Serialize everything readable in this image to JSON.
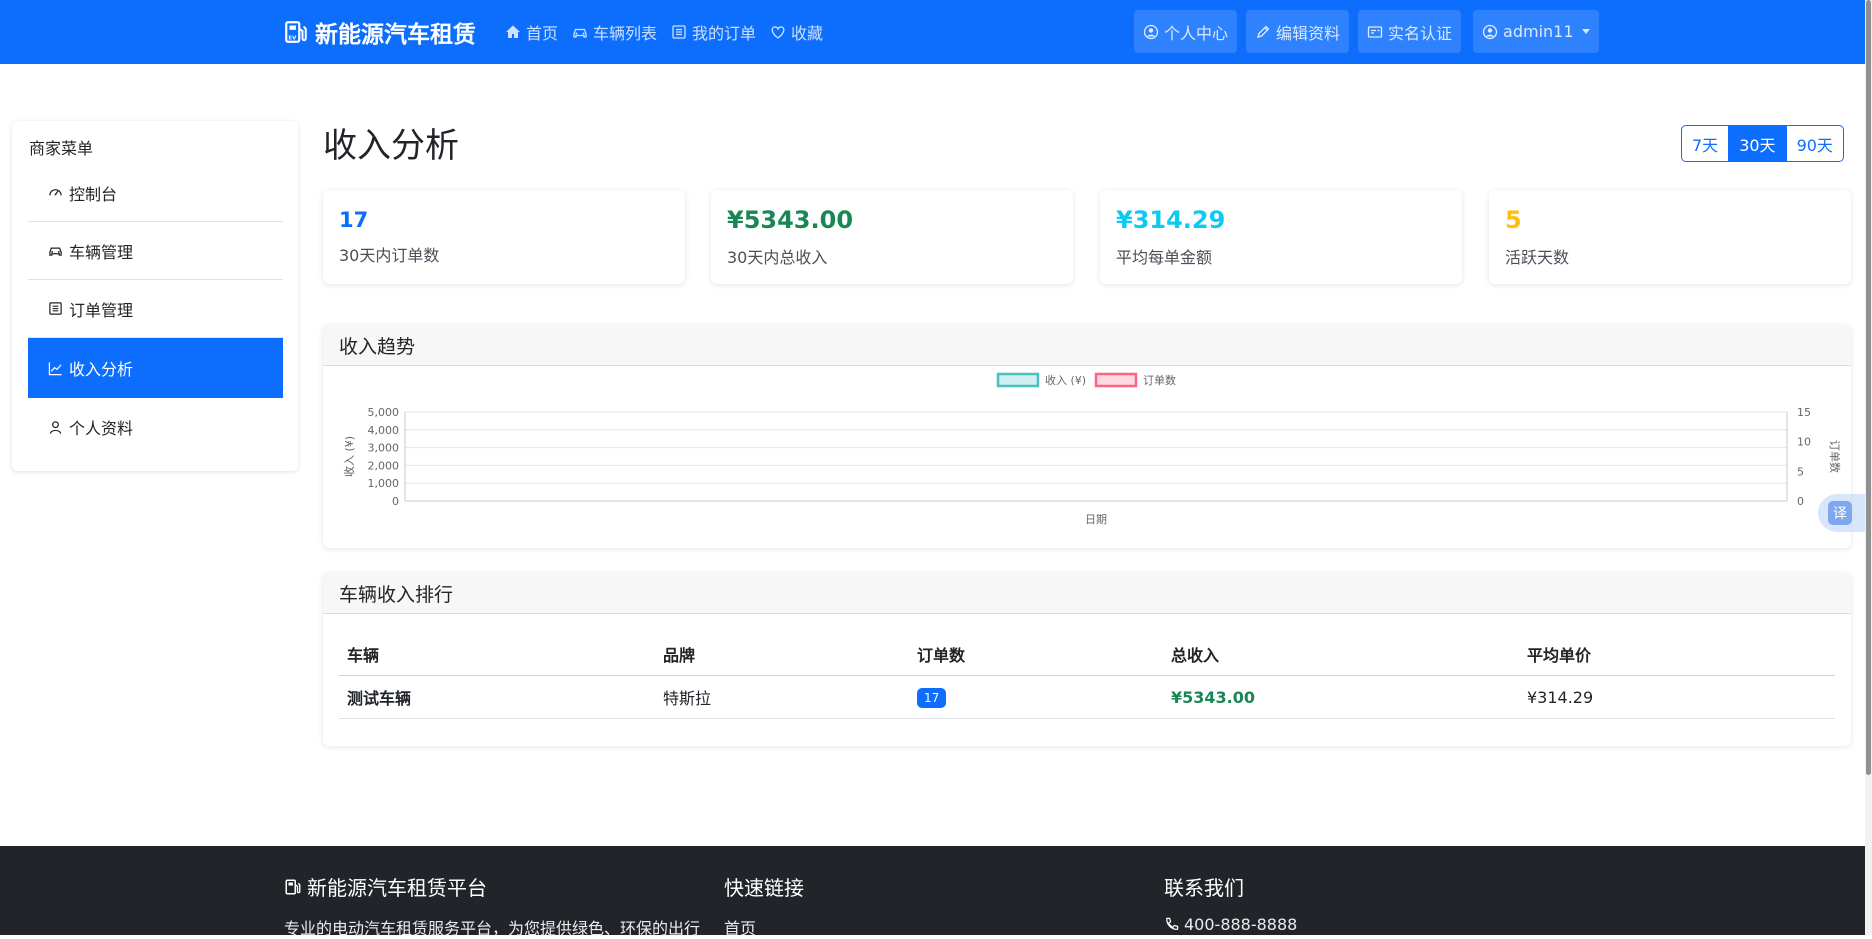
{
  "navbar": {
    "brand": "新能源汽车租赁",
    "links": [
      "首页",
      "车辆列表",
      "我的订单",
      "收藏"
    ],
    "buttons": [
      "个人中心",
      "编辑资料",
      "实名认证"
    ],
    "user": "admin11"
  },
  "sidebar": {
    "title": "商家菜单",
    "items": [
      "控制台",
      "车辆管理",
      "订单管理",
      "收入分析",
      "个人资料"
    ],
    "active": "收入分析"
  },
  "main": {
    "title": "收入分析",
    "ranges": [
      "7天",
      "30天",
      "90天"
    ],
    "active_range": "30天",
    "stats": [
      {
        "value": "17",
        "label": "30天内订单数",
        "color": "#0d6efd"
      },
      {
        "value": "¥5343.00",
        "label": "30天内总收入",
        "color": "#198754"
      },
      {
        "value": "¥314.29",
        "label": "平均每单金额",
        "color": "#0dcaf0"
      },
      {
        "value": "5",
        "label": "活跃天数",
        "color": "#ffc107"
      }
    ]
  },
  "trend": {
    "title": "收入趋势"
  },
  "chart_data": {
    "type": "line",
    "series": [
      {
        "name": "收入 (¥)",
        "values": [],
        "color": "#4bc0c0"
      },
      {
        "name": "订单数",
        "values": [],
        "color": "#ff6384"
      }
    ],
    "x": [],
    "xlabel": "日期",
    "ylabel": "收入 (¥)",
    "y2label": "订单数",
    "ylim": [
      0,
      5000
    ],
    "y2lim": [
      0,
      15
    ],
    "yticks": [
      "5,000",
      "4,000",
      "3,000",
      "2,000",
      "1,000",
      "0"
    ],
    "y2ticks": [
      "15",
      "10",
      "5",
      "0"
    ],
    "legend": "top-center",
    "grid": true
  },
  "ranking": {
    "title": "车辆收入排行",
    "columns": [
      "车辆",
      "品牌",
      "订单数",
      "总收入",
      "平均单价"
    ],
    "rows": [
      {
        "vehicle": "测试车辆",
        "brand": "特斯拉",
        "orders": "17",
        "total": "¥5343.00",
        "avg": "¥314.29"
      }
    ]
  },
  "translate": "译",
  "footer": {
    "brand": "新能源汽车租赁平台",
    "desc": "专业的电动汽车租赁服务平台，为您提供绿色、环保的出行",
    "links_title": "快速链接",
    "link": "首页",
    "contact_title": "联系我们",
    "phone": "400-888-8888"
  }
}
